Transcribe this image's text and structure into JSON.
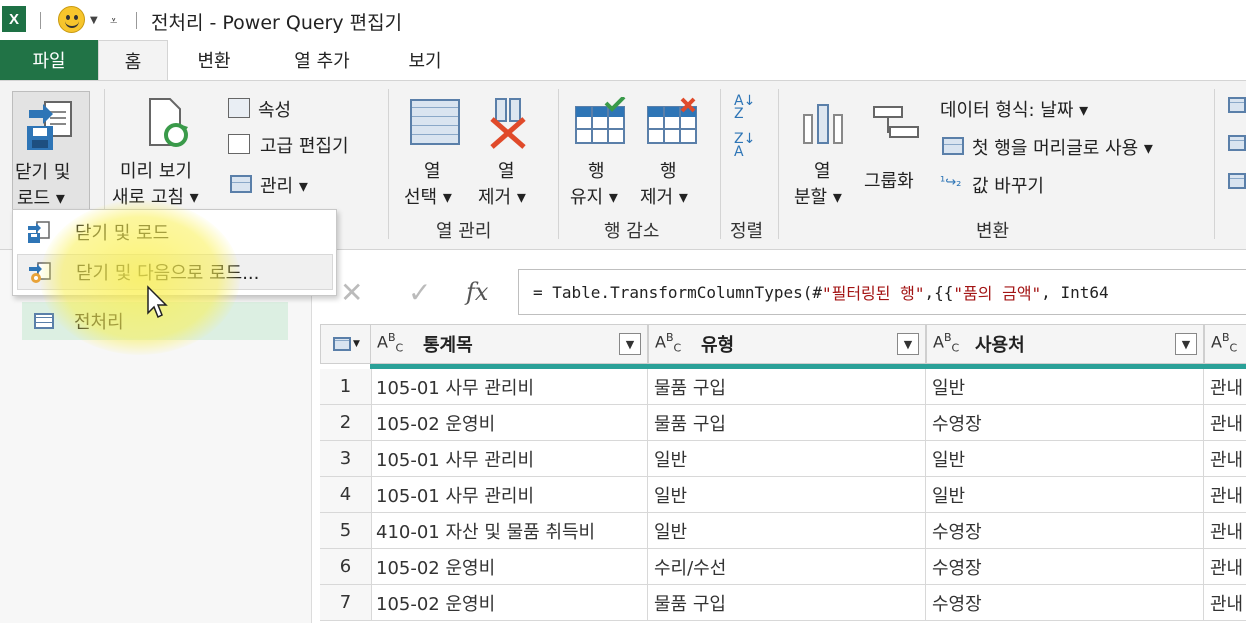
{
  "window": {
    "title": "전처리 - Power Query 편집기",
    "app_icon": "X"
  },
  "tabs": [
    {
      "label": "파일"
    },
    {
      "label": "홈"
    },
    {
      "label": "변환"
    },
    {
      "label": "열 추가"
    },
    {
      "label": "보기"
    }
  ],
  "ribbon": {
    "close_load": {
      "line1": "닫기 및",
      "line2": "로드 ▾"
    },
    "refresh_preview": {
      "line1": "미리 보기",
      "line2": "새로 고침 ▾"
    },
    "properties": "속성",
    "advanced_editor": "고급 편집기",
    "manage": "관리 ▾",
    "choose_columns": {
      "line1": "열",
      "line2": "선택 ▾"
    },
    "remove_columns": {
      "line1": "열",
      "line2": "제거 ▾"
    },
    "keep_rows": {
      "line1": "행",
      "line2": "유지 ▾"
    },
    "remove_rows": {
      "line1": "행",
      "line2": "제거 ▾"
    },
    "split_column": {
      "line1": "열",
      "line2": "분할 ▾"
    },
    "group_by": "그룹화",
    "data_type": "데이터 형식: 날짜 ▾",
    "use_first_row": "첫 행을 머리글로 사용 ▾",
    "replace_values": "값 바꾸기",
    "groups": {
      "manage_columns": "열 관리",
      "reduce_rows": "행 감소",
      "sort": "정렬",
      "transform": "변환"
    }
  },
  "dropdown_menu": {
    "items": [
      {
        "label": "닫기 및 로드"
      },
      {
        "label": "닫기 및 다음으로 로드..."
      }
    ]
  },
  "queries_pane": {
    "items": [
      {
        "label": "전처리"
      }
    ]
  },
  "formula_bar": {
    "prefix": "= Table.TransformColumnTypes(#",
    "s1": "\"필터링된 행\"",
    "mid": ",{{",
    "s2": "\"품의 금액\"",
    "suffix": ", Int64"
  },
  "table": {
    "columns": [
      {
        "name": "통계목",
        "type": "ABC"
      },
      {
        "name": "유형",
        "type": "ABC"
      },
      {
        "name": "사용처",
        "type": "ABC"
      },
      {
        "name": "",
        "type": "ABC"
      }
    ],
    "rows": [
      {
        "n": "1",
        "c1": "105-01 사무 관리비",
        "c2": "물품 구입",
        "c3": "일반",
        "c4": "관내"
      },
      {
        "n": "2",
        "c1": "105-02 운영비",
        "c2": "물품 구입",
        "c3": "수영장",
        "c4": "관내"
      },
      {
        "n": "3",
        "c1": "105-01 사무 관리비",
        "c2": "일반",
        "c3": "일반",
        "c4": "관내"
      },
      {
        "n": "4",
        "c1": "105-01 사무 관리비",
        "c2": "일반",
        "c3": "일반",
        "c4": "관내"
      },
      {
        "n": "5",
        "c1": "410-01 자산 및 물품 취득비",
        "c2": "일반",
        "c3": "수영장",
        "c4": "관내"
      },
      {
        "n": "6",
        "c1": "105-02 운영비",
        "c2": "수리/수선",
        "c3": "수영장",
        "c4": "관내"
      },
      {
        "n": "7",
        "c1": "105-02 운영비",
        "c2": "물품 구입",
        "c3": "수영장",
        "c4": "관내"
      }
    ]
  },
  "colors": {
    "excel_green": "#217346",
    "highlight_yellow": "#faf050",
    "query_selected": "#dcefe2",
    "header_line": "#2aa198"
  }
}
